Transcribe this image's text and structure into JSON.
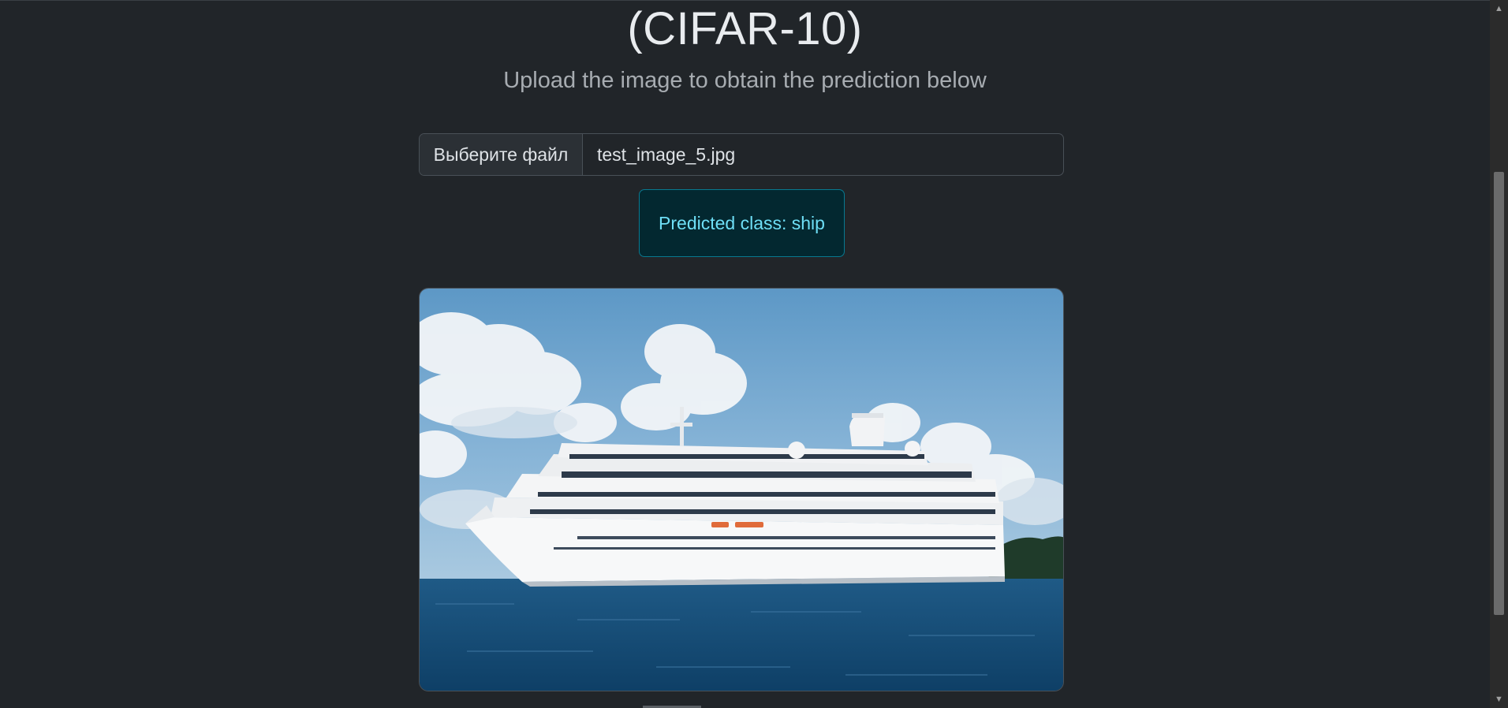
{
  "header": {
    "title": "(CIFAR-10)",
    "subtitle": "Upload the image to obtain the prediction below"
  },
  "upload": {
    "button_label": "Выберите файл",
    "file_name": "test_image_5.jpg"
  },
  "result": {
    "text": "Predicted class: ship"
  },
  "image": {
    "alt": "test_image_5.jpg",
    "subject": "cruise ship at sea"
  },
  "colors": {
    "background": "#212529",
    "alert_bg": "#032830",
    "alert_border": "#087990",
    "alert_text": "#6edff6"
  },
  "icons": {
    "scroll_up": "triangle-up-icon",
    "scroll_down": "triangle-down-icon"
  }
}
